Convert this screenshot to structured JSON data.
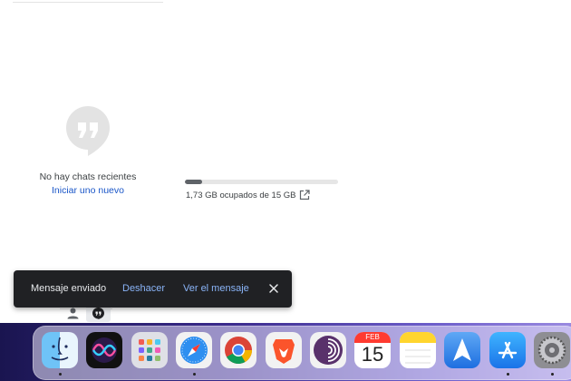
{
  "chat_panel": {
    "empty_title": "No hay chats recientes",
    "start_link": "Iniciar uno nuevo"
  },
  "storage": {
    "usage_text": "1,73 GB ocupados de 15 GB",
    "used_fraction": 0.115
  },
  "toast": {
    "message": "Mensaje enviado",
    "undo": "Deshacer",
    "view": "Ver el mensaje"
  },
  "dock": {
    "calendar_month": "FEB",
    "calendar_day": "15",
    "apps": [
      "finder",
      "siri",
      "launchpad",
      "safari",
      "chrome",
      "brave",
      "tor-browser",
      "calendar",
      "notes",
      "spark",
      "app-store",
      "system-preferences"
    ]
  }
}
